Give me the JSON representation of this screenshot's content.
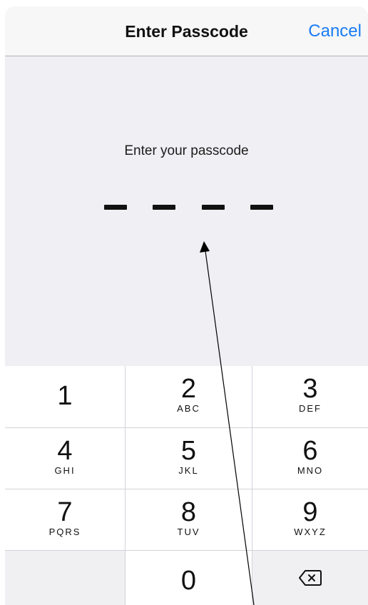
{
  "navbar": {
    "title": "Enter Passcode",
    "cancel_label": "Cancel"
  },
  "passcode": {
    "prompt": "Enter your passcode",
    "digits_entered": 0,
    "digits_total": 4
  },
  "keypad": {
    "keys": [
      {
        "digit": "1",
        "letters": ""
      },
      {
        "digit": "2",
        "letters": "ABC"
      },
      {
        "digit": "3",
        "letters": "DEF"
      },
      {
        "digit": "4",
        "letters": "GHI"
      },
      {
        "digit": "5",
        "letters": "JKL"
      },
      {
        "digit": "6",
        "letters": "MNO"
      },
      {
        "digit": "7",
        "letters": "PQRS"
      },
      {
        "digit": "8",
        "letters": "TUV"
      },
      {
        "digit": "9",
        "letters": "WXYZ"
      },
      {
        "digit": "0",
        "letters": ""
      }
    ],
    "delete_icon": "delete-backspace-icon"
  },
  "colors": {
    "accent": "#1a7cf5",
    "background": "#efeff4",
    "keypad_gap": "#d1d3d9",
    "key": "#ffffff"
  },
  "annotation": {
    "icon": "arrow-icon"
  }
}
